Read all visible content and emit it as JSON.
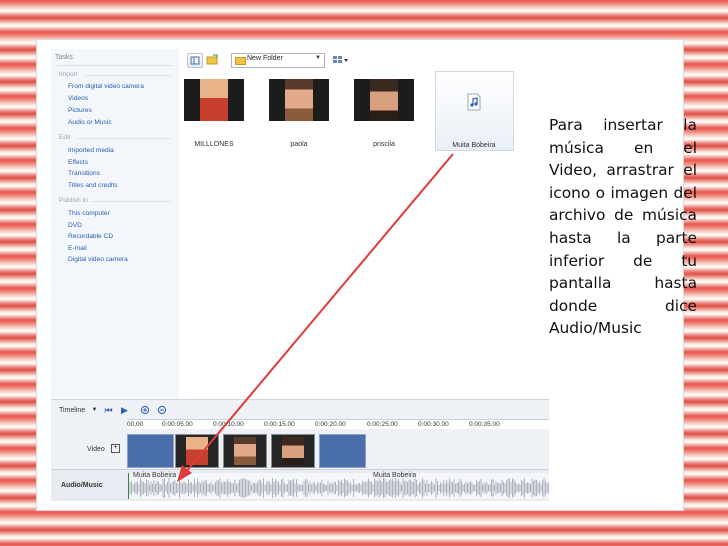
{
  "tasks": {
    "header": "Tasks",
    "sections": [
      {
        "title": "Import",
        "items": [
          "From digital video camera",
          "Videos",
          "Pictures",
          "Audio or Music"
        ]
      },
      {
        "title": "Edit",
        "items": [
          "Imported media",
          "Effects",
          "Transitions",
          "Titles and credits"
        ]
      },
      {
        "title": "Publish to",
        "items": [
          "This computer",
          "DVD",
          "Recordable CD",
          "E-mail",
          "Digital video camera"
        ]
      }
    ]
  },
  "toolbar": {
    "folder": "New Folder"
  },
  "media": [
    {
      "label": "MILLLONES",
      "icon": "photo-thumbnail"
    },
    {
      "label": "paola",
      "icon": "photo-thumbnail"
    },
    {
      "label": "priscila",
      "icon": "photo-thumbnail"
    },
    {
      "label": "Muita Bobeira",
      "icon": "music-file-icon"
    }
  ],
  "timeline": {
    "label": "Timeline",
    "ticks": [
      "00,00",
      "0:00:05.00",
      "0:00:10.00",
      "0:00:15.00",
      "0:00:20.00",
      "0:00:25.00",
      "0:00:30.00",
      "0:00:35.00"
    ],
    "video_track_label": "Video",
    "audio_track_label": "Audio/Music",
    "audio_clips": [
      "Muita Bobeira",
      "Muita Bobeira"
    ]
  },
  "caption": "Para insertar la música en el Video, arrastrar el icono o imagen del archivo de música hasta la parte inferior de tu pantalla hasta donde dice Audio/Music",
  "colors": {
    "arrow": "#e03a3a",
    "link": "#2a5fae",
    "clip_blue": "#4a6ea8"
  }
}
